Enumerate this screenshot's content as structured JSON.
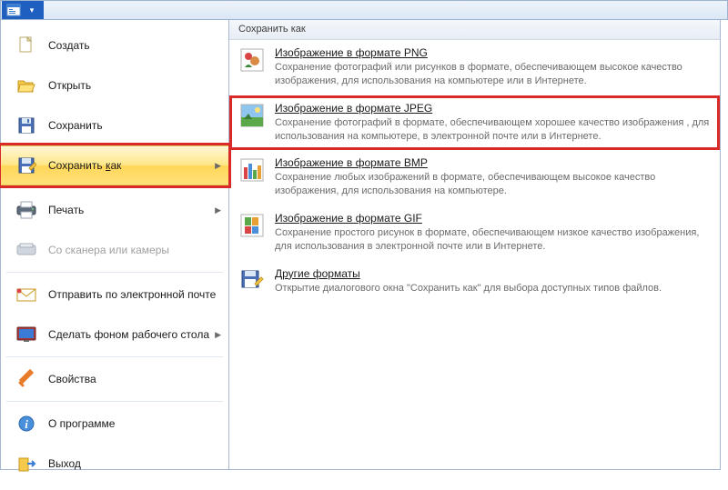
{
  "titlebar": {
    "qat_dropdown_glyph": "▾"
  },
  "leftMenu": {
    "create": "Создать",
    "open": "Открыть",
    "save": "Сохранить",
    "saveAs_pre": "Сохранить ",
    "saveAs_u": "к",
    "saveAs_post": "ак",
    "print": "Печать",
    "scanner": "Со сканера или камеры",
    "email": "Отправить по электронной почте",
    "wallpaper": "Сделать фоном рабочего стола",
    "properties": "Свойства",
    "about": "О программе",
    "exit": "Выход"
  },
  "rightPanel": {
    "header": "Сохранить как",
    "png": {
      "title": "Изображение в формате PNG",
      "desc": "Сохранение фотографий или рисунков в формате, обеспечивающем высокое качество изображения, для использования на компьютере или в Интернете."
    },
    "jpeg": {
      "title_pre": "Изобра",
      "title_u": "ж",
      "title_post": "ение в формате JPEG",
      "desc": "Сохранение фотографий в формате, обеспечивающем хорошее качество изображения , для использования на компьютере, в электронной почте или в Интернете."
    },
    "bmp": {
      "title": "Изображение в формате BMP",
      "desc": "Сохранение любых изображений в формате, обеспечивающем высокое качество изображения, для использования на компьютере."
    },
    "gif": {
      "title": "Изображение в формате GIF",
      "desc": "Сохранение простого рисунок в формате, обеспечивающем низкое качество изображения, для использования в электронной почте или в Интернете."
    },
    "other": {
      "title": "Другие форматы",
      "desc": "Открытие диалогового окна \"Сохранить как\" для выбора доступных типов файлов."
    }
  }
}
